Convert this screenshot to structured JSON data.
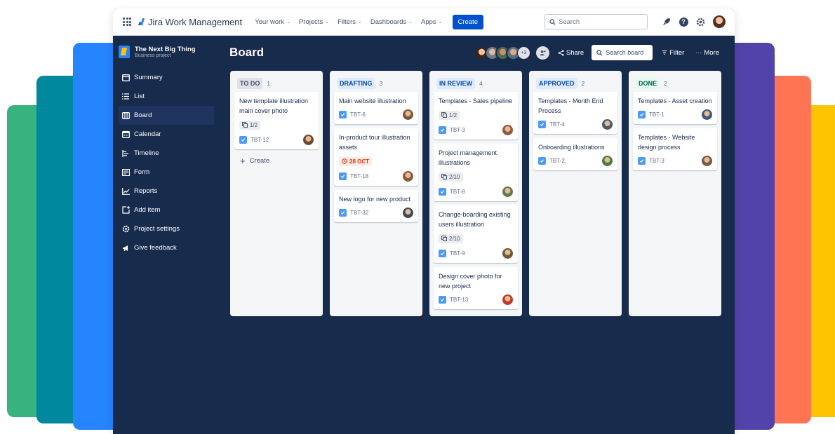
{
  "topbar": {
    "brand": "Jira Work Management",
    "nav": [
      {
        "label": "Your work"
      },
      {
        "label": "Projects"
      },
      {
        "label": "Filters"
      },
      {
        "label": "Dashboards"
      },
      {
        "label": "Apps"
      }
    ],
    "create_label": "Create",
    "search_placeholder": "Search"
  },
  "sidebar": {
    "project_name": "The Next Big Thing",
    "project_type": "Business project",
    "items": [
      {
        "label": "Summary",
        "icon": "summary-icon"
      },
      {
        "label": "List",
        "icon": "list-icon"
      },
      {
        "label": "Board",
        "icon": "board-icon",
        "active": true
      },
      {
        "label": "Calendar",
        "icon": "calendar-icon"
      },
      {
        "label": "Timeline",
        "icon": "timeline-icon"
      },
      {
        "label": "Form",
        "icon": "form-icon"
      },
      {
        "label": "Reports",
        "icon": "reports-icon"
      },
      {
        "label": "Add item",
        "icon": "add-item-icon"
      },
      {
        "label": "Project settings",
        "icon": "gear-icon"
      },
      {
        "label": "Give feedback",
        "icon": "megaphone-icon"
      }
    ]
  },
  "board": {
    "title": "Board",
    "more_avatars": "+3",
    "share_label": "Share",
    "search_placeholder": "Search board",
    "filter_label": "Filter",
    "more_label": "More"
  },
  "columns": [
    {
      "name": "TO DO",
      "count": "1",
      "badge_bg": "#dfe1e6",
      "badge_color": "#42526e",
      "cards": [
        {
          "title": "New template illustration main cover photo",
          "subtasks": "1/2",
          "key": "TBT-12",
          "avatar": "#6b4a32"
        }
      ],
      "create_label": "Create"
    },
    {
      "name": "DRAFTING",
      "count": "3",
      "badge_bg": "#deebff",
      "badge_color": "#0747a6",
      "cards": [
        {
          "title": "Main website illustration",
          "key": "TBT-6",
          "avatar": "#7a5a3a"
        },
        {
          "title": "In-product tour illustration assets",
          "due": "28 OCT",
          "key": "TBT-18",
          "avatar": "#8a5a3c"
        },
        {
          "title": "New logo for new product",
          "key": "TBT-32",
          "avatar": "#3c4a5e"
        }
      ]
    },
    {
      "name": "IN REVIEW",
      "count": "4",
      "badge_bg": "#deebff",
      "badge_color": "#0747a6",
      "cards": [
        {
          "title": "Templates - Sales pipeline",
          "subtasks": "1/2",
          "key": "TBT-3",
          "avatar": "#8e5a3e"
        },
        {
          "title": "Project management illustrations",
          "subtasks": "2/10",
          "key": "TBT-8",
          "avatar": "#5e7a4e"
        },
        {
          "title": "Change-boarding existing users illustration",
          "subtasks": "2/10",
          "key": "TBT-9",
          "avatar": "#6e5a3a"
        },
        {
          "title": "Design cover photo for new project",
          "key": "TBT-13",
          "avatar": "#c0392b"
        }
      ]
    },
    {
      "name": "APPROVED",
      "count": "2",
      "badge_bg": "#deebff",
      "badge_color": "#0747a6",
      "cards": [
        {
          "title": "Templates - Month End Process",
          "key": "TBT-4",
          "avatar": "#4a5a6e"
        },
        {
          "title": "Onboarding illustrations",
          "key": "TBT-2",
          "avatar": "#4e7a4a"
        }
      ]
    },
    {
      "name": "DONE",
      "count": "2",
      "badge_bg": "#e3fcef",
      "badge_color": "#006644",
      "cards": [
        {
          "title": "Templates - Asset creation",
          "key": "TBT-1",
          "avatar": "#3e5a7a"
        },
        {
          "title": "Templates - Website design process",
          "key": "TBT-3",
          "avatar": "#7a5a48"
        }
      ]
    }
  ],
  "colors": {
    "brand_blue": "#0052cc",
    "nav_background": "#172b4d",
    "card_check": "#4c9aff"
  }
}
